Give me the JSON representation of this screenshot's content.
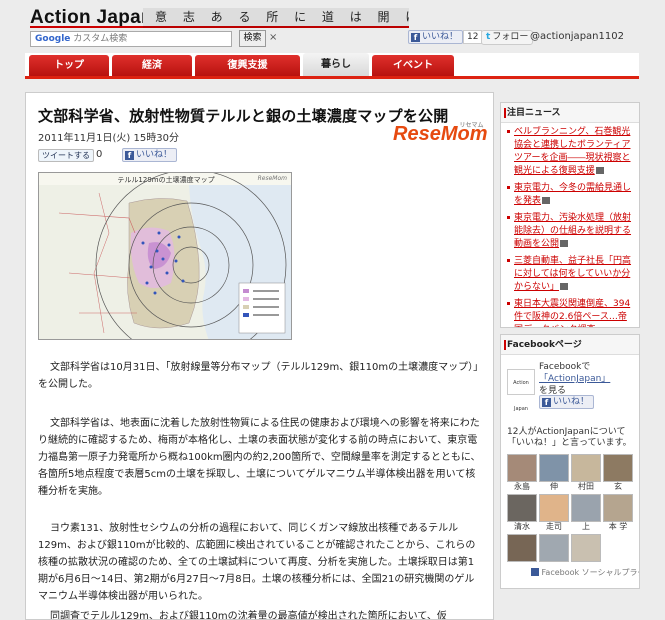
{
  "header": {
    "logo": "Action Japan!",
    "motto": "意 志 あ る 所 に 道 は 開 け る 。",
    "search_placeholder": "カスタム検索",
    "search_brand": "Google",
    "search_button": "検索",
    "clear": "×",
    "like_label": "いいね！",
    "like_count": "12",
    "follow_label": "フォロー",
    "twitter_handle": "@actionjapan1102"
  },
  "nav": {
    "tabs": [
      {
        "label": "トップ"
      },
      {
        "label": "経済"
      },
      {
        "label": "復興支援"
      },
      {
        "label": "暮らし"
      },
      {
        "label": "イベント"
      }
    ]
  },
  "article": {
    "title": "文部科学省、放射性物質テルルと銀の土壌濃度マップを公開",
    "date": "2011年11月1日(火) 15時30分",
    "source_logo": "ReseMom",
    "source_logo_small": "リセマム",
    "tweet_label": "ツイートする",
    "tweet_count": "0",
    "like_label": "いいね！",
    "map_caption": "テルル129mの土壌濃度マップ",
    "map_credit": "ReseMom",
    "paragraphs": [
      "文部科学省は10月31日、「放射線量等分布マップ（テルル129m、銀110mの土壌濃度マップ）」を公開した。",
      "文部科学省は、地表面に沈着した放射性物質による住民の健康および環境への影響を将来にわたり継続的に確認するため、梅雨が本格化し、土壌の表面状態が変化する前の時点において、東京電力福島第一原子力発電所から概ね100km圏内の約2,200箇所で、空間線量率を測定するとともに、各箇所5地点程度で表層5cmの土壌を採取し、土壌についてゲルマニウム半導体検出器を用いて核種分析を実施。",
      "ヨウ素131、放射性セシウムの分析の過程において、同じくガンマ線放出核種であるテルル129m、および銀110mが比較的、広範囲に検出されていることが確認されたことから、これらの核種の拡散状況の確認のため、全ての土壌試料について再度、分析を実施した。土壌採取日は第1期が6月6日〜14日、第2期が6月27日〜7月8日。土壌の核種分析には、全国21の研究機関のゲルマニウム半導体検出器が用いられた。",
      "同調査でテルル129m、および銀110mの沈着量の最高値が検出された箇所において、仮"
    ]
  },
  "sidebar": {
    "news_title": "注目ニュース",
    "news": [
      {
        "text": "ベルブランニング、石巻観光協会と連携したボランティアツアーを企画――現状視察と観光による復興支援"
      },
      {
        "text": "東京電力、今冬の需給見通しを発表"
      },
      {
        "text": "東京電力、汚染水処理（放射能除去）の仕組みを説明する動画を公開"
      },
      {
        "text": "三菱自動車、益子社長「円高に対しては何をしていいか分からない」"
      },
      {
        "text": "東日本大震災関連倒産、394件で阪神の2.6倍ペース…帝国データバンク調査"
      }
    ],
    "facebook_title": "Facebookページ",
    "fb_logo_text": "Action Japan",
    "fb_text_before": "Facebookで",
    "fb_link": "「ActionJapan」",
    "fb_text_after": "を見る",
    "fb_like": "いいね！",
    "fans_text": "12人がActionJapanについて「いいね！」と言っています。",
    "fans": [
      {
        "name": "永島"
      },
      {
        "name": "伸"
      },
      {
        "name": "村田"
      },
      {
        "name": "麻"
      },
      {
        "name": "佐藤"
      },
      {
        "name": "玄"
      },
      {
        "name": "清水"
      },
      {
        "name": "幹"
      },
      {
        "name": "美"
      },
      {
        "name": "走司"
      },
      {
        "name": "上"
      },
      {
        "name": "本 学"
      }
    ],
    "plugin_text": "Facebook ソーシャルプラグイン"
  }
}
